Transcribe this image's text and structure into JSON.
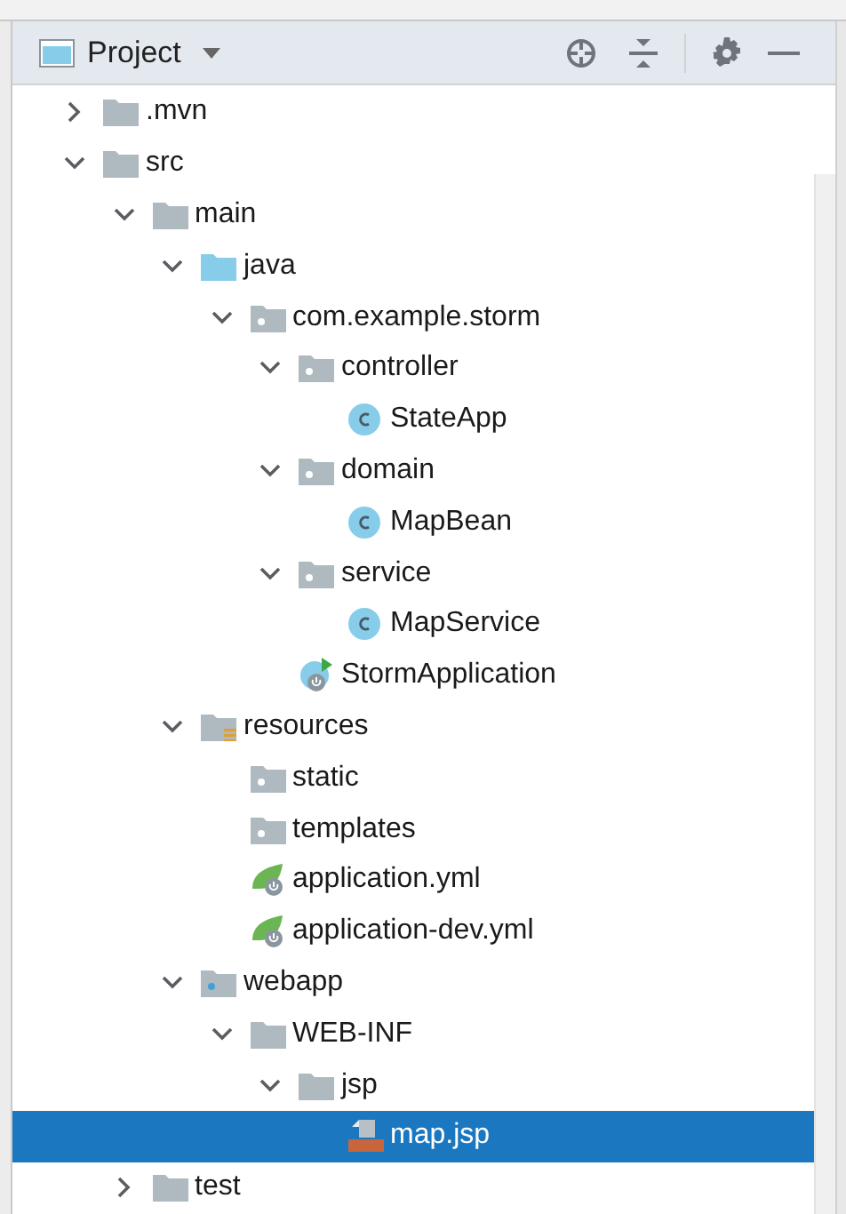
{
  "header": {
    "title": "Project"
  },
  "tree": [
    {
      "label": ".mvn",
      "kind": "folder",
      "expanded": false,
      "selected": false
    },
    {
      "label": "src",
      "kind": "folder",
      "expanded": true,
      "selected": false,
      "children": [
        {
          "label": "main",
          "kind": "folder",
          "expanded": true,
          "selected": false,
          "children": [
            {
              "label": "java",
              "kind": "source",
              "expanded": true,
              "selected": false,
              "children": [
                {
                  "label": "com.example.storm",
                  "kind": "package",
                  "expanded": true,
                  "selected": false,
                  "children": [
                    {
                      "label": "controller",
                      "kind": "package",
                      "expanded": true,
                      "selected": false,
                      "children": [
                        {
                          "label": "StateApp",
                          "kind": "class",
                          "selected": false
                        }
                      ]
                    },
                    {
                      "label": "domain",
                      "kind": "package",
                      "expanded": true,
                      "selected": false,
                      "children": [
                        {
                          "label": "MapBean",
                          "kind": "class",
                          "selected": false
                        }
                      ]
                    },
                    {
                      "label": "service",
                      "kind": "package",
                      "expanded": true,
                      "selected": false,
                      "children": [
                        {
                          "label": "MapService",
                          "kind": "class",
                          "selected": false
                        }
                      ]
                    },
                    {
                      "label": "StormApplication",
                      "kind": "app",
                      "selected": false
                    }
                  ]
                }
              ]
            },
            {
              "label": "resources",
              "kind": "resources",
              "expanded": true,
              "selected": false,
              "children": [
                {
                  "label": "static",
                  "kind": "package",
                  "selected": false
                },
                {
                  "label": "templates",
                  "kind": "package",
                  "selected": false
                },
                {
                  "label": "application.yml",
                  "kind": "spring",
                  "selected": false
                },
                {
                  "label": "application-dev.yml",
                  "kind": "spring",
                  "selected": false
                }
              ]
            },
            {
              "label": "webapp",
              "kind": "web",
              "expanded": true,
              "selected": false,
              "children": [
                {
                  "label": "WEB-INF",
                  "kind": "folder",
                  "expanded": true,
                  "selected": false,
                  "children": [
                    {
                      "label": "jsp",
                      "kind": "folder",
                      "expanded": true,
                      "selected": false,
                      "children": [
                        {
                          "label": "map.jsp",
                          "kind": "jsp",
                          "selected": true
                        }
                      ]
                    }
                  ]
                }
              ]
            }
          ]
        },
        {
          "label": "test",
          "kind": "folder",
          "expanded": false,
          "selected": false
        }
      ]
    }
  ]
}
